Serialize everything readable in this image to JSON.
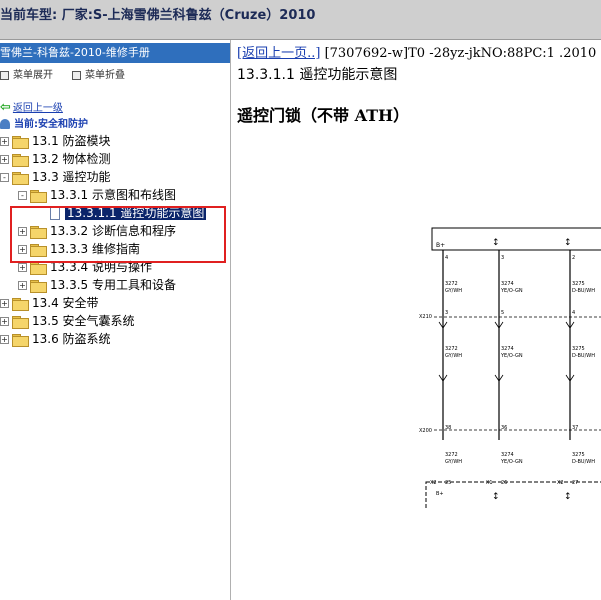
{
  "window": {
    "title": "当前车型:  厂家:S-上海雪佛兰科鲁兹（Cruze）2010"
  },
  "sidebar": {
    "manual_title": "雪佛兰-科鲁兹-2010-维修手册",
    "expand_label": "菜单展开",
    "collapse_label": "菜单折叠",
    "back_label": "返回上一级",
    "current_label": "当前:安全和防护",
    "tree": [
      {
        "label": "13.1 防盗模块",
        "expander": "+"
      },
      {
        "label": "13.2 物体检测",
        "expander": "+"
      },
      {
        "label": "13.3 遥控功能",
        "expander": "-"
      },
      {
        "label": "13.3.1 示意图和布线图",
        "expander": "-"
      },
      {
        "label": "13.3.1.1 遥控功能示意图",
        "expander": "",
        "selected": true
      },
      {
        "label": "13.3.2 诊断信息和程序",
        "expander": "+"
      },
      {
        "label": "13.3.3 维修指南",
        "expander": "+"
      },
      {
        "label": "13.3.4 说明与操作",
        "expander": "+"
      },
      {
        "label": "13.3.5 专用工具和设备",
        "expander": "+"
      },
      {
        "label": "13.4 安全带",
        "expander": "+"
      },
      {
        "label": "13.5 安全气囊系统",
        "expander": "+"
      },
      {
        "label": "13.6 防盗系统",
        "expander": "+"
      }
    ]
  },
  "content": {
    "back_link": "[返回上一页..]",
    "doc_ref": "[7307692-w]T0 -28yz-jkNO:88PC:1 .2010",
    "section_title": "13.3.1.1 遥控功能示意图",
    "diagram_title": "遥控门锁（不带 ATH）"
  },
  "diagram": {
    "top_box_label": "B+",
    "bottom_box_label": "B+",
    "connectors": [
      "X210",
      "X200"
    ],
    "bottom_connectors": [
      "X2",
      "X1",
      "X2"
    ],
    "pins_top": [
      "4",
      "3",
      "2"
    ],
    "pins_x210": [
      "3",
      "5",
      "4"
    ],
    "pins_x200": [
      "38",
      "36",
      "37"
    ],
    "pins_bottom": [
      "25",
      "26",
      "27"
    ],
    "wire_circuits": [
      "3272",
      "3274",
      "3275"
    ],
    "wire_colors": [
      "GY/WH",
      "YE/O-GN",
      "D-BU/WH"
    ]
  }
}
